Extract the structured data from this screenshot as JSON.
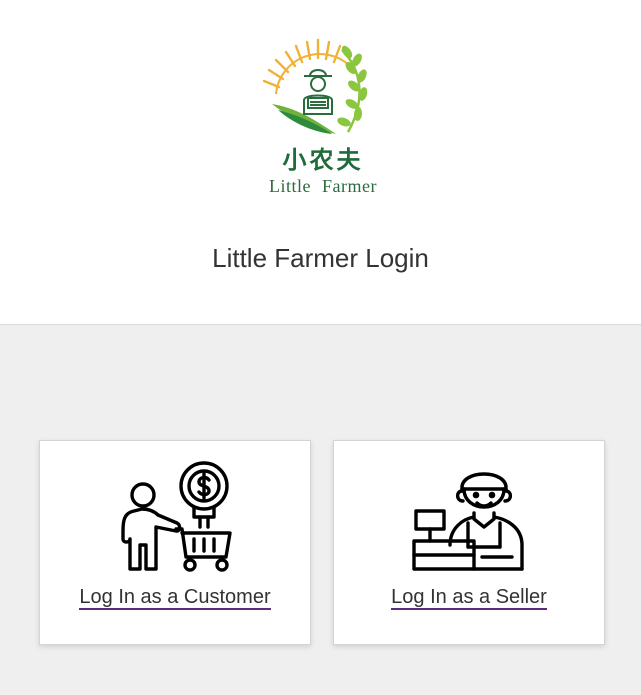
{
  "logo": {
    "cn_text": "小农夫",
    "en_text": "Little Farmer",
    "colors": {
      "sun": "#f2b134",
      "leaf": "#8cc63f",
      "green": "#1f6b3a"
    }
  },
  "page": {
    "title": "Little Farmer Login"
  },
  "cards": {
    "customer": {
      "link_label": "Log In as a Customer",
      "icon": "shopper-cart-icon"
    },
    "seller": {
      "link_label": "Log In as a Seller",
      "icon": "cashier-seller-icon"
    }
  },
  "colors": {
    "link_underline": "#5b2c7a",
    "background": "#efefef"
  }
}
